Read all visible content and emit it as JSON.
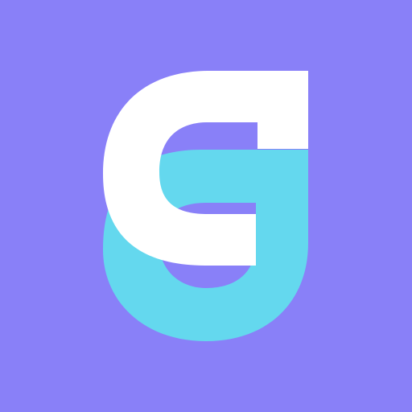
{
  "app_icon": {
    "icon": "g-monogram-logo",
    "colors": {
      "background": "#8980F8",
      "primary_shape": "#FFFFFF",
      "secondary_shape": "#64D8EE"
    }
  }
}
